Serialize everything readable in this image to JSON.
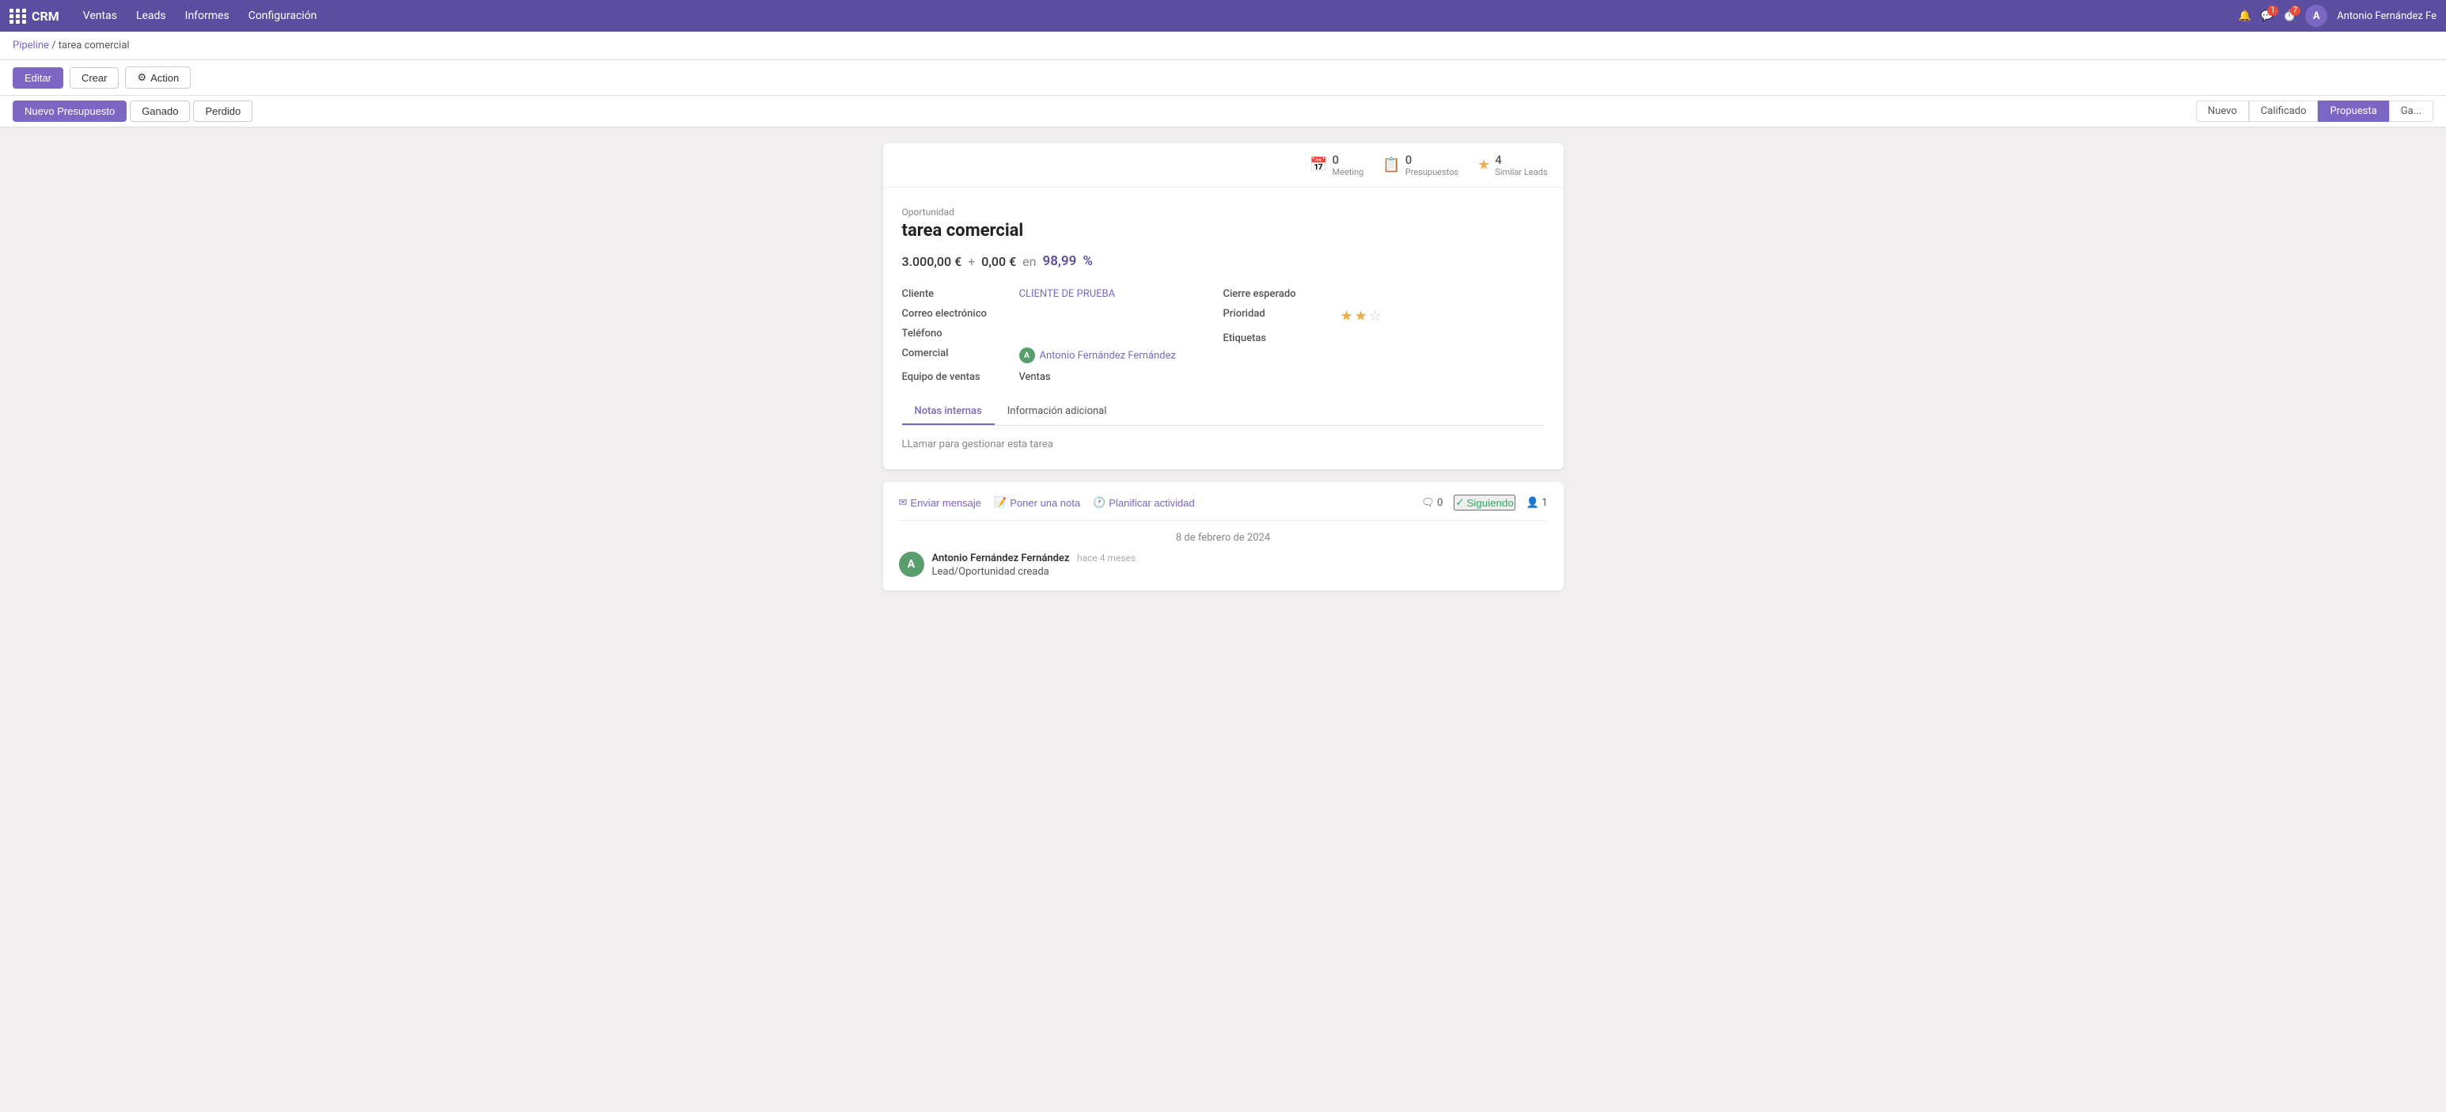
{
  "topnav": {
    "brand": "CRM",
    "menu": [
      "Ventas",
      "Leads",
      "Informes",
      "Configuración"
    ],
    "user_name": "Antonio Fernández Fe",
    "user_initial": "A"
  },
  "breadcrumb": {
    "parent": "Pipeline",
    "separator": "/",
    "current": "tarea comercial"
  },
  "toolbar": {
    "edit_label": "Editar",
    "create_label": "Crear",
    "action_label": "Action"
  },
  "status_buttons": {
    "nuevo_presupuesto": "Nuevo Presupuesto",
    "ganado": "Ganado",
    "perdido": "Perdido"
  },
  "stages": {
    "nuevo": "Nuevo",
    "calificado": "Calificado",
    "propuesta": "Propuesta",
    "ganado": "Ga..."
  },
  "card": {
    "stats": {
      "meeting_count": "0",
      "meeting_label": "Meeting",
      "presupuestos_count": "0",
      "presupuestos_label": "Presupuestos",
      "similar_leads_count": "4",
      "similar_leads_label": "Similar Leads"
    },
    "opportunity_label": "Oportunidad",
    "opportunity_title": "tarea comercial",
    "revenue": {
      "main": "3.000,00 €",
      "plus": "+",
      "extra": "0,00 €",
      "en": "en",
      "pct": "98,99",
      "pct_symbol": "%"
    },
    "fields": {
      "cliente_label": "Cliente",
      "cliente_value": "CLIENTE DE PRUEBA",
      "correo_label": "Correo electrónico",
      "correo_value": "",
      "telefono_label": "Teléfono",
      "telefono_value": "",
      "comercial_label": "Comercial",
      "comercial_value": "Antonio Fernández Fernández",
      "comercial_initial": "A",
      "equipo_label": "Equipo de ventas",
      "equipo_value": "Ventas",
      "cierre_label": "Cierre esperado",
      "cierre_value": "",
      "prioridad_label": "Prioridad",
      "etiquetas_label": "Etiquetas",
      "etiquetas_value": ""
    },
    "tabs": {
      "notas_internas": "Notas internas",
      "informacion_adicional": "Información adicional"
    },
    "notes_text": "LLamar para gestionar esta tarea"
  },
  "chatter": {
    "send_message": "Enviar mensaje",
    "add_note": "Poner una nota",
    "plan_activity": "Planificar actividad",
    "comments_count": "0",
    "following_label": "Siguiendo",
    "followers_count": "1",
    "date": "8 de febrero de 2024",
    "entry": {
      "author": "Antonio Fernández Fernández",
      "time": "hace 4 meses",
      "message": "Lead/Oportunidad creada",
      "initial": "A"
    }
  }
}
